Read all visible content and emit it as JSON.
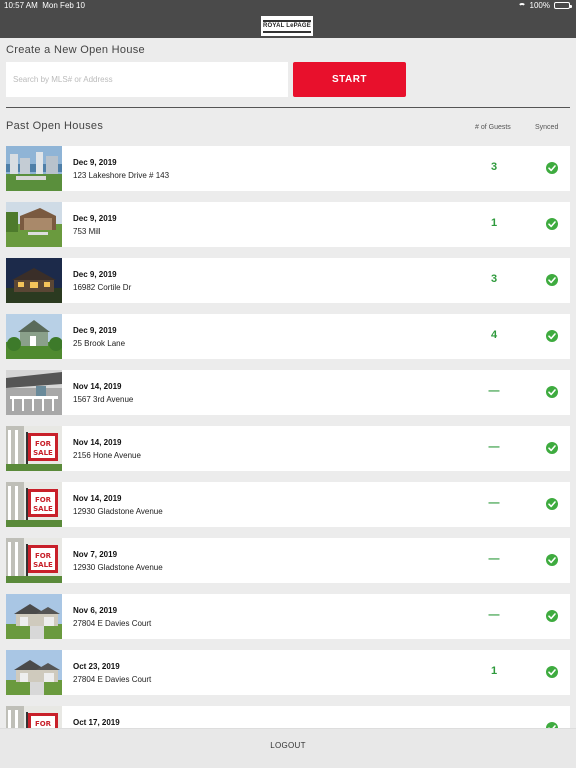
{
  "status_bar": {
    "time": "10:57 AM",
    "date": "Mon Feb 10",
    "battery": "100%"
  },
  "header": {
    "logo_text": "ROYAL LePAGE"
  },
  "create": {
    "title": "Create a New Open House",
    "search_placeholder": "Search by MLS# or Address",
    "search_value": "",
    "start_label": "START"
  },
  "past": {
    "title": "Past Open Houses",
    "col_guests": "# of Guests",
    "col_synced": "Synced",
    "items": [
      {
        "date": "Dec 9, 2019",
        "address": "123 Lakeshore Drive # 143",
        "guests": "3",
        "thumb": "waterfront-condo"
      },
      {
        "date": "Dec 9, 2019",
        "address": "753 Mill",
        "guests": "1",
        "thumb": "country-house"
      },
      {
        "date": "Dec 9, 2019",
        "address": "16982 Cortile Dr",
        "guests": "3",
        "thumb": "dusk-house"
      },
      {
        "date": "Dec 9, 2019",
        "address": "25 Brook Lane",
        "guests": "4",
        "thumb": "cottage"
      },
      {
        "date": "Nov 14, 2019",
        "address": "1567 3rd Avenue",
        "guests": "—",
        "thumb": "porch"
      },
      {
        "date": "Nov 14, 2019",
        "address": "2156 Hone Avenue",
        "guests": "—",
        "thumb": "for-sale-sign"
      },
      {
        "date": "Nov 14, 2019",
        "address": "12930 Gladstone Avenue",
        "guests": "—",
        "thumb": "for-sale-sign"
      },
      {
        "date": "Nov 7, 2019",
        "address": "12930 Gladstone Avenue",
        "guests": "—",
        "thumb": "for-sale-sign"
      },
      {
        "date": "Nov 6, 2019",
        "address": "27804 E Davies Court",
        "guests": "—",
        "thumb": "suburban-house"
      },
      {
        "date": "Oct 23, 2019",
        "address": "27804 E Davies Court",
        "guests": "1",
        "thumb": "suburban-house"
      },
      {
        "date": "Oct 17, 2019",
        "address": "",
        "guests": "",
        "thumb": "for-sale-sign"
      }
    ]
  },
  "footer": {
    "logout_label": "LOGOUT"
  },
  "colors": {
    "accent": "#e8102c",
    "header_bg": "#4a4a4a",
    "guests_green": "#2e9a3c",
    "synced_green": "#3eab3f"
  }
}
